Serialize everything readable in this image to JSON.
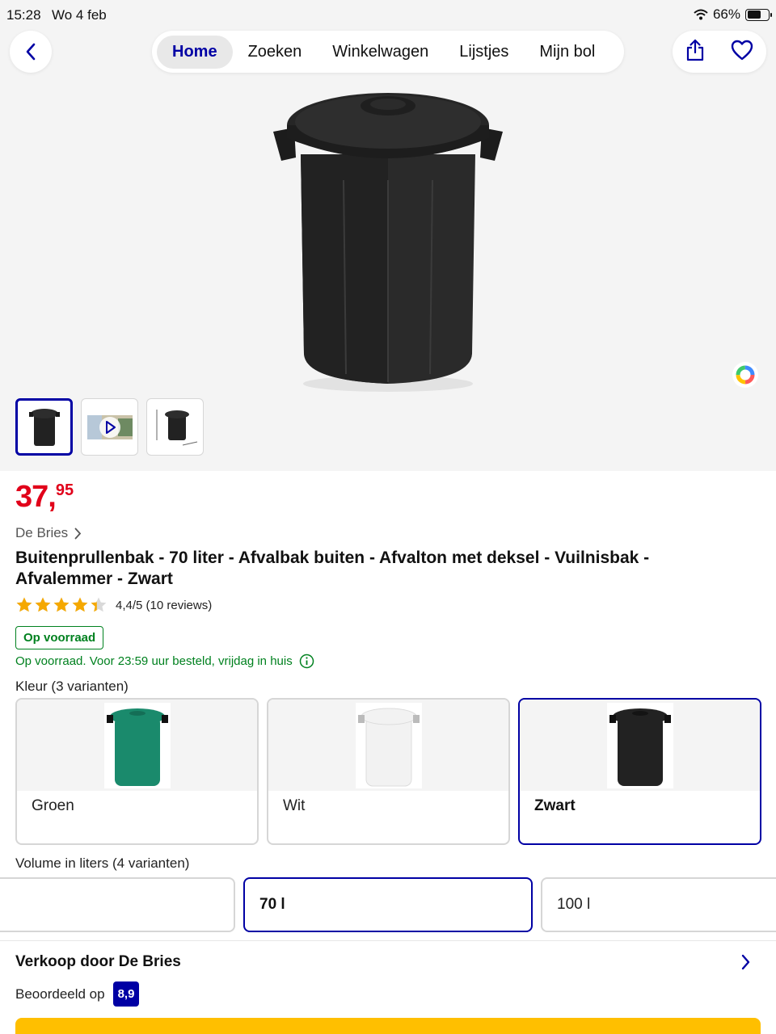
{
  "status_bar": {
    "time": "15:28",
    "date": "Wo 4 feb",
    "battery": "66%",
    "battery_level": 0.66
  },
  "nav": {
    "tabs": [
      {
        "label": "Home",
        "active": true
      },
      {
        "label": "Zoeken"
      },
      {
        "label": "Winkelwagen"
      },
      {
        "label": "Lijstjes"
      },
      {
        "label": "Mijn bol"
      }
    ],
    "icons": [
      "chevron-left-icon",
      "share-icon",
      "heart-icon"
    ]
  },
  "product": {
    "price_whole": "37,",
    "price_cents": "95",
    "brand": "De Bries",
    "title": "Buitenprullenbak - 70 liter - Afvalbak buiten - Afvalton met deksel - Vuilnisbak - Afvalemmer - Zwart",
    "rating_value": 4.4,
    "rating_text": "4,4/5 (10 reviews)",
    "stock_badge": "Op voorraad",
    "delivery_text": "Op voorraad. Voor 23:59 uur besteld, vrijdag in huis"
  },
  "variants": {
    "color_label": "Kleur (3 varianten)",
    "colors": [
      {
        "name": "Groen",
        "swatch": "#1a8a6c"
      },
      {
        "name": "Wit",
        "swatch": "#f2f2f2"
      },
      {
        "name": "Zwart",
        "swatch": "#222222",
        "selected": true
      }
    ],
    "volume_label": "Volume in liters (4 varianten)",
    "volumes": [
      {
        "name": ""
      },
      {
        "name": "70 l",
        "selected": true
      },
      {
        "name": "100 l"
      }
    ]
  },
  "seller": {
    "title": "Verkoop door De Bries",
    "rated_label": "Beoordeeld op",
    "score": "8,9"
  },
  "colors": {
    "brand_blue": "#0000a4",
    "price_red": "#e1001a",
    "stock_green": "#00811f",
    "cta_yellow": "#ffbf00"
  }
}
